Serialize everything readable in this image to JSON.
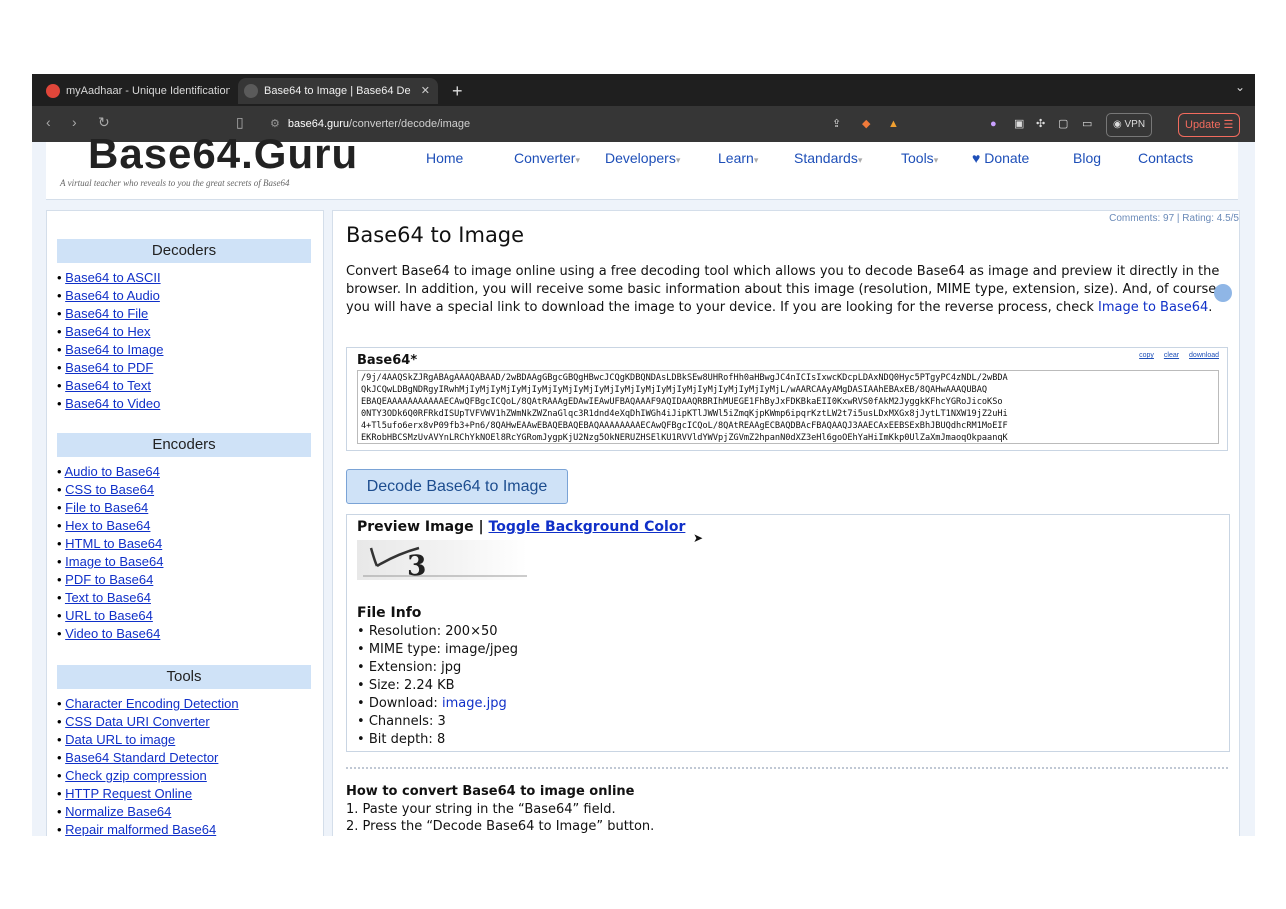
{
  "browser": {
    "tabs": [
      {
        "title": "myAadhaar - Unique Identification",
        "active": false
      },
      {
        "title": "Base64 to Image | Base64 De",
        "active": true
      }
    ],
    "url_domain": "base64.guru",
    "url_path": "/converter/decode/image",
    "vpn_label": "VPN",
    "update_label": "Update"
  },
  "site": {
    "logo": "Base64.Guru",
    "tagline": "A virtual teacher who reveals to you the great secrets of Base64",
    "nav": [
      "Home",
      "Converter",
      "Developers",
      "Learn",
      "Standards",
      "Tools",
      "Donate",
      "Blog",
      "Contacts"
    ]
  },
  "sidebar": {
    "decoders_title": "Decoders",
    "decoders": [
      "Base64 to ASCII",
      "Base64 to Audio",
      "Base64 to File",
      "Base64 to Hex",
      "Base64 to Image",
      "Base64 to PDF",
      "Base64 to Text",
      "Base64 to Video"
    ],
    "encoders_title": "Encoders",
    "encoders": [
      "Audio to Base64",
      "CSS to Base64",
      "File to Base64",
      "Hex to Base64",
      "HTML to Base64",
      "Image to Base64",
      "PDF to Base64",
      "Text to Base64",
      "URL to Base64",
      "Video to Base64"
    ],
    "tools_title": "Tools",
    "tools": [
      "Character Encoding Detection",
      "CSS Data URI Converter",
      "Data URL to image",
      "Base64 Standard Detector",
      "Check gzip compression",
      "HTTP Request Online",
      "Normalize Base64",
      "Repair malformed Base64"
    ]
  },
  "main": {
    "meta": "Comments: 97 | Rating: 4.5/5",
    "title": "Base64 to Image",
    "intro": "Convert Base64 to image online using a free decoding tool which allows you to decode Base64 as image and preview it directly in the browser. In addition, you will receive some basic information about this image (resolution, MIME type, extension, size). And, of course, you will have a special link to download the image to your device. If you are looking for the reverse process, check ",
    "intro_link": "Image to Base64",
    "base64_label": "Base64*",
    "tools": [
      "copy",
      "clear",
      "download"
    ],
    "base64_value": "/9j/4AAQSkZJRgABAgAAAQABAAD/2wBDAAgGBgcGBQgHBwcJCQgKDBQNDAsLDBkSEw8UHRofHh0aHBwgJC4nICIsIxwcKDcpLDAxNDQ0Hyc5PTgyPC4zNDL/2wBDA\nQkJCQwLDBgNDRgyIRwhMjIyMjIyMjIyMjIyMjIyMjIyMjIyMjIyMjIyMjIyMjIyMjIyMjIyMjIyMjIyMjL/wAARCAAyAMgDASIAAhEBAxEB/8QAHwAAAQUBAQ\nEBAQEAAAAAAAAAAAECAwQFBgcICQoL/8QAtRAAAgEDAwIEAwUFBAQAAAF9AQIDAAQRBRIhMUEGE1FhByJxFDKBkaEII0KxwRVS0fAkM2JyggkKFhcYGRoJicoKSo\n0NTY3ODk6Q0RFRkdISUpTVFVWV1hZWmNkZWZnaGlqc3R1dnd4eXqDhIWGh4iJipKTlJWWl5iZmqKjpKWmp6ipqrKztLW2t7i5usLDxMXGx8jJytLT1NXW19jZ2uHi\n4+Tl5ufo6erx8vP09fb3+Pn6/8QAHwEAAwEBAQEBAQEBAQAAAAAAAAECAwQFBgcICQoL/8QAtREAAgECBAQDBAcFBAQAAQJ3AAECAxEEBSExBhJBUQdhcRM1MoEIF\nEKRobHBCSMzUvAVYnLRChYkNOEl8RcYGRomJygpKjU2Nzg5OkNERUZHSElKU1RVVldYWVpjZGVmZ2hpanN0dXZ3eHl6goOEhYaHiImKkp0UlZaXmJmaoqOkpaanqK",
    "decode_button": "Decode Base64 to Image",
    "preview_label": "Preview Image",
    "preview_sep": " | ",
    "toggle_bg": "Toggle Background Color",
    "fileinfo_title": "File Info",
    "fileinfo": [
      {
        "label": "Resolution: ",
        "value": "200×50"
      },
      {
        "label": "MIME type: ",
        "value": "image/jpeg"
      },
      {
        "label": "Extension: ",
        "value": "jpg"
      },
      {
        "label": "Size: ",
        "value": "2.24 KB"
      },
      {
        "label": "Download: ",
        "value": "image.jpg",
        "link": true
      },
      {
        "label": "Channels: ",
        "value": "3"
      },
      {
        "label": "Bit depth: ",
        "value": "8"
      }
    ],
    "howto_title": "How to convert Base64 to image online",
    "howto_steps": [
      "1. Paste your string in the “Base64” field.",
      "2. Press the “Decode Base64 to Image” button."
    ]
  }
}
